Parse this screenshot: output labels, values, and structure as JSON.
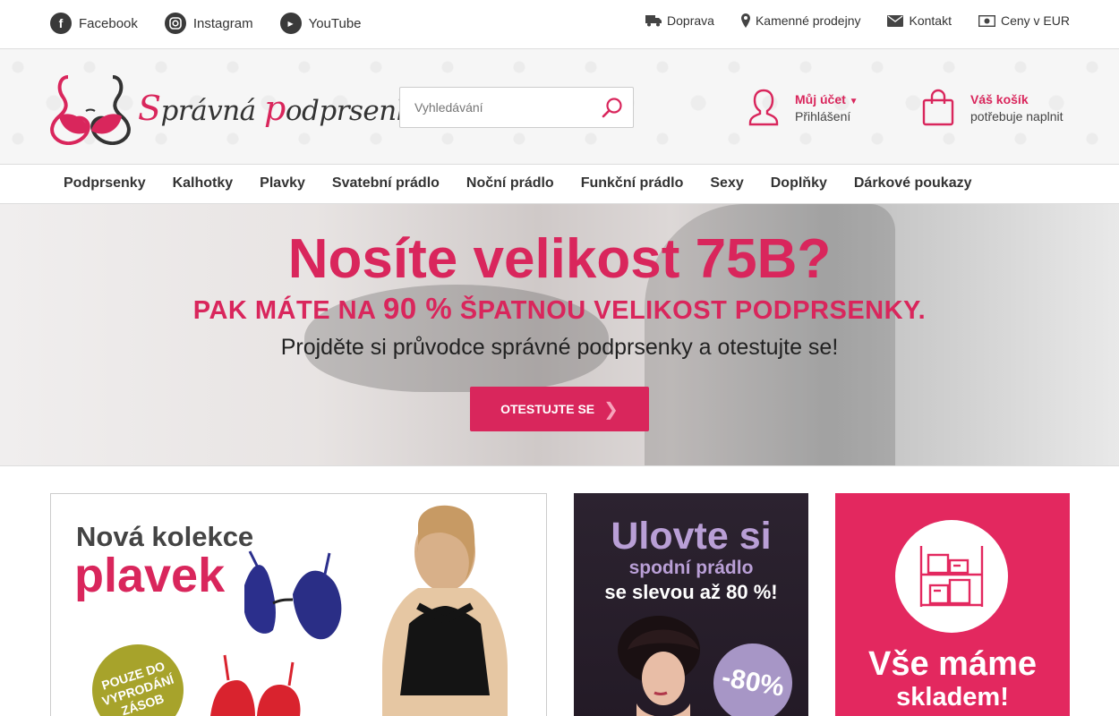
{
  "topbar": {
    "social": [
      {
        "label": "Facebook",
        "icon": "facebook-icon"
      },
      {
        "label": "Instagram",
        "icon": "instagram-icon"
      },
      {
        "label": "YouTube",
        "icon": "youtube-icon"
      }
    ],
    "links": [
      {
        "label": "Doprava",
        "icon": "truck-icon"
      },
      {
        "label": "Kamenné prodejny",
        "icon": "map-pin-icon"
      },
      {
        "label": "Kontakt",
        "icon": "envelope-icon"
      },
      {
        "label": "Ceny v EUR",
        "icon": "money-icon"
      }
    ]
  },
  "header": {
    "logo_first": "S",
    "logo_mid": "právná ",
    "logo_p": "p",
    "logo_rest": "odprsenka",
    "search_placeholder": "Vyhledávání",
    "account_label": "Můj účet",
    "account_sub": "Přihlášení",
    "cart_label": "Váš košík",
    "cart_sub": "potřebuje naplnit"
  },
  "nav": {
    "items": [
      "Podprsenky",
      "Kalhotky",
      "Plavky",
      "Svatební prádlo",
      "Noční prádlo",
      "Funkční prádlo",
      "Sexy",
      "Doplňky",
      "Dárkové poukazy"
    ]
  },
  "hero": {
    "title": "Nosíte velikost 75B?",
    "subtitle_pre": "PAK MÁTE NA ",
    "subtitle_big": "90 %",
    "subtitle_post": " ŠPATNOU VELIKOST PODPRSENKY.",
    "text": "Projděte si průvodce správné podprsenky a otestujte se!",
    "cta": "OTESTUJTE SE"
  },
  "promos": {
    "p1_line1": "Nová kolekce",
    "p1_line2": "plavek",
    "p1_badge": "POUZE DO VYPRODÁNÍ ZÁSOB",
    "p2_line1": "Ulovte si",
    "p2_line2": "spodní prádlo",
    "p2_line3": "se slevou až 80 %!",
    "p2_badge": "-80%",
    "p3_line1": "Vše máme",
    "p3_line2": "skladem!"
  },
  "colors": {
    "accent": "#d9265c",
    "promo_pink": "#e3285f",
    "promo_purple": "#b99fd6"
  }
}
